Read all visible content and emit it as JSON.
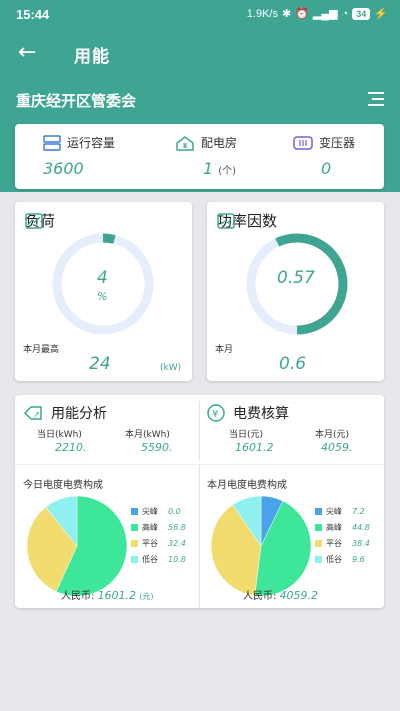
{
  "status_bar": {
    "time": "15:44",
    "speed": "1.9K/s",
    "battery": "34"
  },
  "header": {
    "title": "用能",
    "org": "重庆经开区管委会"
  },
  "summary": [
    {
      "label": "运行容量",
      "value": "3600",
      "unit": ""
    },
    {
      "label": "配电房",
      "value": "1",
      "unit": "(个)"
    },
    {
      "label": "变压器",
      "value": "0",
      "unit": ""
    }
  ],
  "load": {
    "title": "负荷",
    "center_value": "4",
    "center_unit": "%",
    "percent": 4,
    "sub_label": "本月最高",
    "sub_value": "24",
    "unit": "(kW)"
  },
  "power_factor": {
    "title": "功率因数",
    "center_value": "0.57",
    "fraction": 0.57,
    "sub_label": "本月",
    "sub_value": "0.6"
  },
  "energy": {
    "title": "用能分析",
    "today_label": "当日(kWh)",
    "today_value": "2210.",
    "month_label": "本月(kWh)",
    "month_value": "5590."
  },
  "cost": {
    "title": "电费核算",
    "today_label": "当日(元)",
    "today_value": "1601.2",
    "month_label": "本月(元)",
    "month_value": "4059."
  },
  "pie_today": {
    "title": "今日电度电费构成",
    "items": [
      {
        "name": "尖峰",
        "value": "0.0"
      },
      {
        "name": "高峰",
        "value": "56.8"
      },
      {
        "name": "平谷",
        "value": "32.4"
      },
      {
        "name": "低谷",
        "value": "10.8"
      }
    ],
    "rmb_label": "人民币:",
    "rmb_value": "1601.2",
    "rmb_unit": "(元)"
  },
  "pie_month": {
    "title": "本月电度电费构成",
    "items": [
      {
        "name": "尖峰",
        "value": "7.2"
      },
      {
        "name": "高峰",
        "value": "44.8"
      },
      {
        "name": "平谷",
        "value": "38.4"
      },
      {
        "name": "低谷",
        "value": "9.6"
      }
    ],
    "rmb_label": "人民币:",
    "rmb_value": "4059.2"
  },
  "colors": {
    "teal": "#3fa593",
    "light": "#e6eefb",
    "jian": "#4aa3e8",
    "gao": "#3ee69a",
    "ping": "#f2dc6e",
    "di": "#8ef0ef"
  }
}
